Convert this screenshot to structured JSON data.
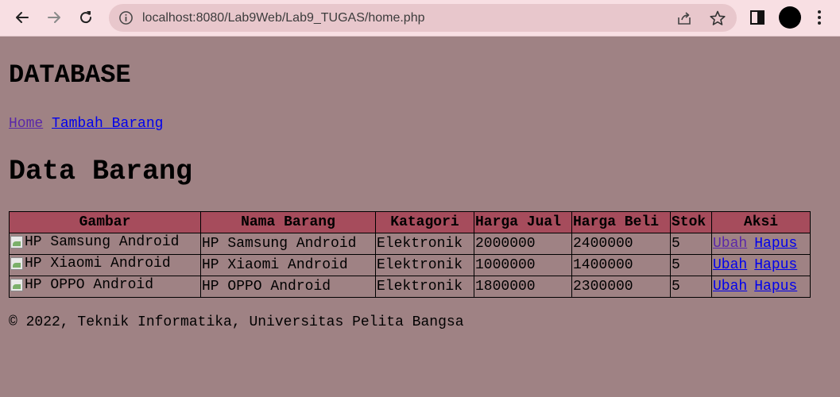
{
  "browser": {
    "url": "localhost:8080/Lab9Web/Lab9_TUGAS/home.php",
    "icons": {
      "back": "back-arrow-icon",
      "forward": "forward-arrow-icon",
      "reload": "reload-icon",
      "info": "info-icon",
      "share": "share-icon",
      "bookmark": "star-icon",
      "side_panel": "side-panel-icon",
      "profile": "profile-avatar",
      "menu": "kebab-menu-icon"
    },
    "colors": {
      "chrome_bg": "#f8dfe3",
      "omnibox_bg": "#e8c7cc"
    }
  },
  "page": {
    "title": "DATABASE",
    "nav": [
      {
        "label": "Home",
        "state": "visited"
      },
      {
        "label": "Tambah Barang",
        "state": "link"
      }
    ],
    "section_title": "Data Barang",
    "table": {
      "columns": [
        "Gambar",
        "Nama Barang",
        "Katagori",
        "Harga Jual",
        "Harga Beli",
        "Stok",
        "Aksi"
      ],
      "rows": [
        {
          "gambar_alt": "HP Samsung Android",
          "nama": "HP Samsung Android",
          "kategori": "Elektronik",
          "harga_jual": "2000000",
          "harga_beli": "2400000",
          "stok": "5",
          "ubah": "Ubah",
          "hapus": "Hapus"
        },
        {
          "gambar_alt": "HP Xiaomi Android",
          "nama": "HP Xiaomi Android",
          "kategori": "Elektronik",
          "harga_jual": "1000000",
          "harga_beli": "1400000",
          "stok": "5",
          "ubah": "Ubah",
          "hapus": "Hapus"
        },
        {
          "gambar_alt": "HP OPPO Android",
          "nama": "HP OPPO Android",
          "kategori": "Elektronik",
          "harga_jual": "1800000",
          "harga_beli": "2300000",
          "stok": "5",
          "ubah": "Ubah",
          "hapus": "Hapus"
        }
      ]
    },
    "footer": "© 2022, Teknik Informatika, Universitas Pelita Bangsa",
    "colors": {
      "page_bg": "#9f8284",
      "header_bg": "#a64c5c",
      "link": "#0000ee",
      "visited": "#5a28a8"
    }
  }
}
